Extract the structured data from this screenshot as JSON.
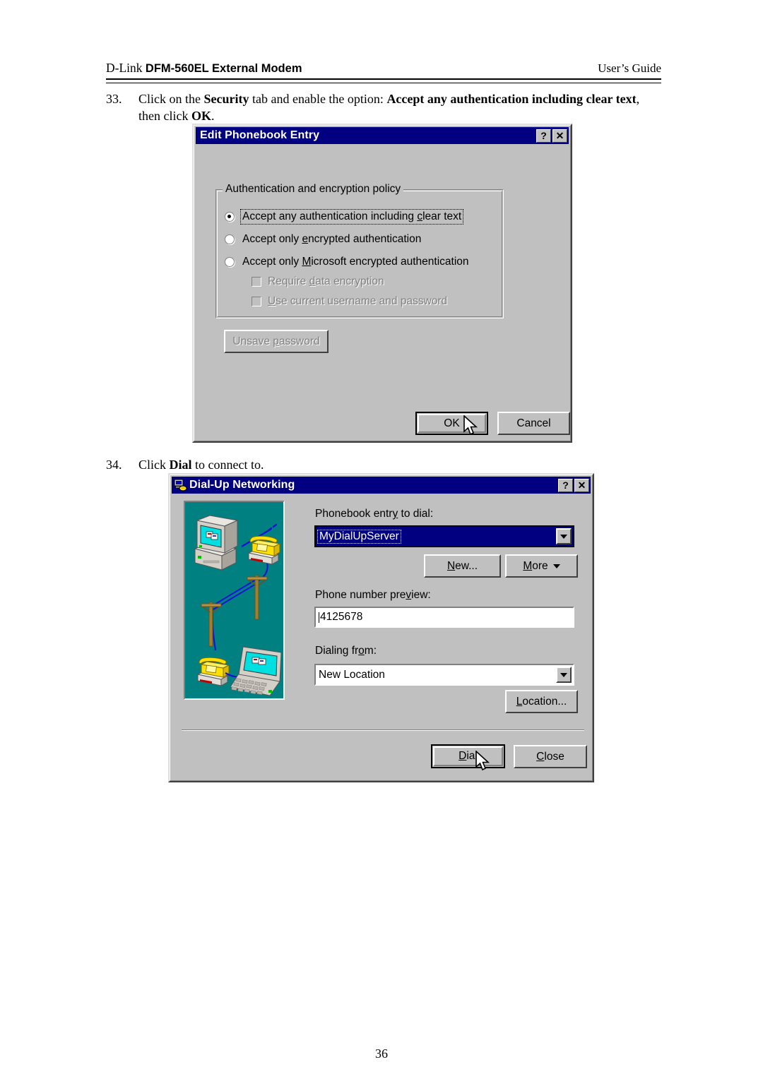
{
  "header": {
    "left_plain": "D-Link ",
    "left_bold": "DFM-560EL External Modem",
    "right": "User’s Guide"
  },
  "steps": [
    {
      "number": "33.",
      "segments": [
        {
          "text": "Click on the ",
          "bold": false
        },
        {
          "text": "Security",
          "bold": true
        },
        {
          "text": " tab and enable the option: ",
          "bold": false
        },
        {
          "text": "Accept any authentication including clear text",
          "bold": true
        },
        {
          "text": ", then click ",
          "bold": false
        },
        {
          "text": "OK",
          "bold": true
        },
        {
          "text": ".",
          "bold": false
        }
      ]
    },
    {
      "number": "34.",
      "segments": [
        {
          "text": "Click ",
          "bold": false
        },
        {
          "text": "Dial",
          "bold": true
        },
        {
          "text": " to connect to.",
          "bold": false
        }
      ]
    }
  ],
  "dialog_edit_phonebook": {
    "title": "Edit Phonebook Entry",
    "title_icon": "none",
    "help_button": "?",
    "close_button": "✕",
    "groupbox_legend": "Authentication and encryption policy",
    "radios": [
      {
        "label_pre": "Accept any authentication including ",
        "accel": "c",
        "label_post": "lear text",
        "checked": true,
        "focused": true,
        "disabled": false
      },
      {
        "label_pre": "Accept only ",
        "accel": "e",
        "label_post": "ncrypted authentication",
        "checked": false,
        "focused": false,
        "disabled": false
      },
      {
        "label_pre": "Accept only ",
        "accel": "M",
        "label_post": "icrosoft encrypted authentication",
        "checked": false,
        "focused": false,
        "disabled": false
      }
    ],
    "checkboxes": [
      {
        "label_pre": "Require ",
        "accel": "d",
        "label_post": "ata encryption",
        "checked": false,
        "disabled": true
      },
      {
        "label_pre": "",
        "accel": "U",
        "label_post": "se current username and password",
        "checked": false,
        "disabled": true
      }
    ],
    "unsave_button": {
      "label_pre": "Unsave ",
      "accel": "p",
      "label_post": "assword",
      "disabled": true
    },
    "ok_button": {
      "label": "OK",
      "default": true
    },
    "cancel_button": {
      "label": "Cancel",
      "default": false
    }
  },
  "dialog_dialup": {
    "title": "Dial-Up Networking",
    "title_icon": "computer-phone-icon",
    "help_button": "?",
    "close_button": "✕",
    "phonebook_label_pre": "Phonebook entr",
    "phonebook_label_accel": "y",
    "phonebook_label_post": " to dial:",
    "phonebook_value": "MyDialUpServer",
    "new_button": {
      "label_pre": "",
      "accel": "N",
      "label_post": "ew..."
    },
    "more_button": {
      "label_pre": "",
      "accel": "M",
      "label_post": "ore",
      "has_arrow": true
    },
    "phone_preview_label_pre": "Phone number pre",
    "phone_preview_label_accel": "v",
    "phone_preview_label_post": "iew:",
    "phone_preview_value": "4125678",
    "dialing_from_label_pre": "Dialing fr",
    "dialing_from_label_accel": "o",
    "dialing_from_label_post": "m:",
    "dialing_from_value": "New Location",
    "location_button": {
      "label_pre": "",
      "accel": "L",
      "label_post": "ocation..."
    },
    "dial_button": {
      "label_pre": "",
      "accel": "D",
      "label_post": "ial",
      "default": true
    },
    "close_btn": {
      "label_pre": "",
      "accel": "C",
      "label_post": "lose",
      "default": false
    },
    "illustration": {
      "name": "dialup-network-illustration",
      "background_color": "#008080",
      "line_color": "#1414d2",
      "phone_color": "#ffe000",
      "computer_color": "#c0c0c0",
      "screen_color": "#00e0e0",
      "pole_color": "#a08030"
    }
  },
  "page_number": "36"
}
